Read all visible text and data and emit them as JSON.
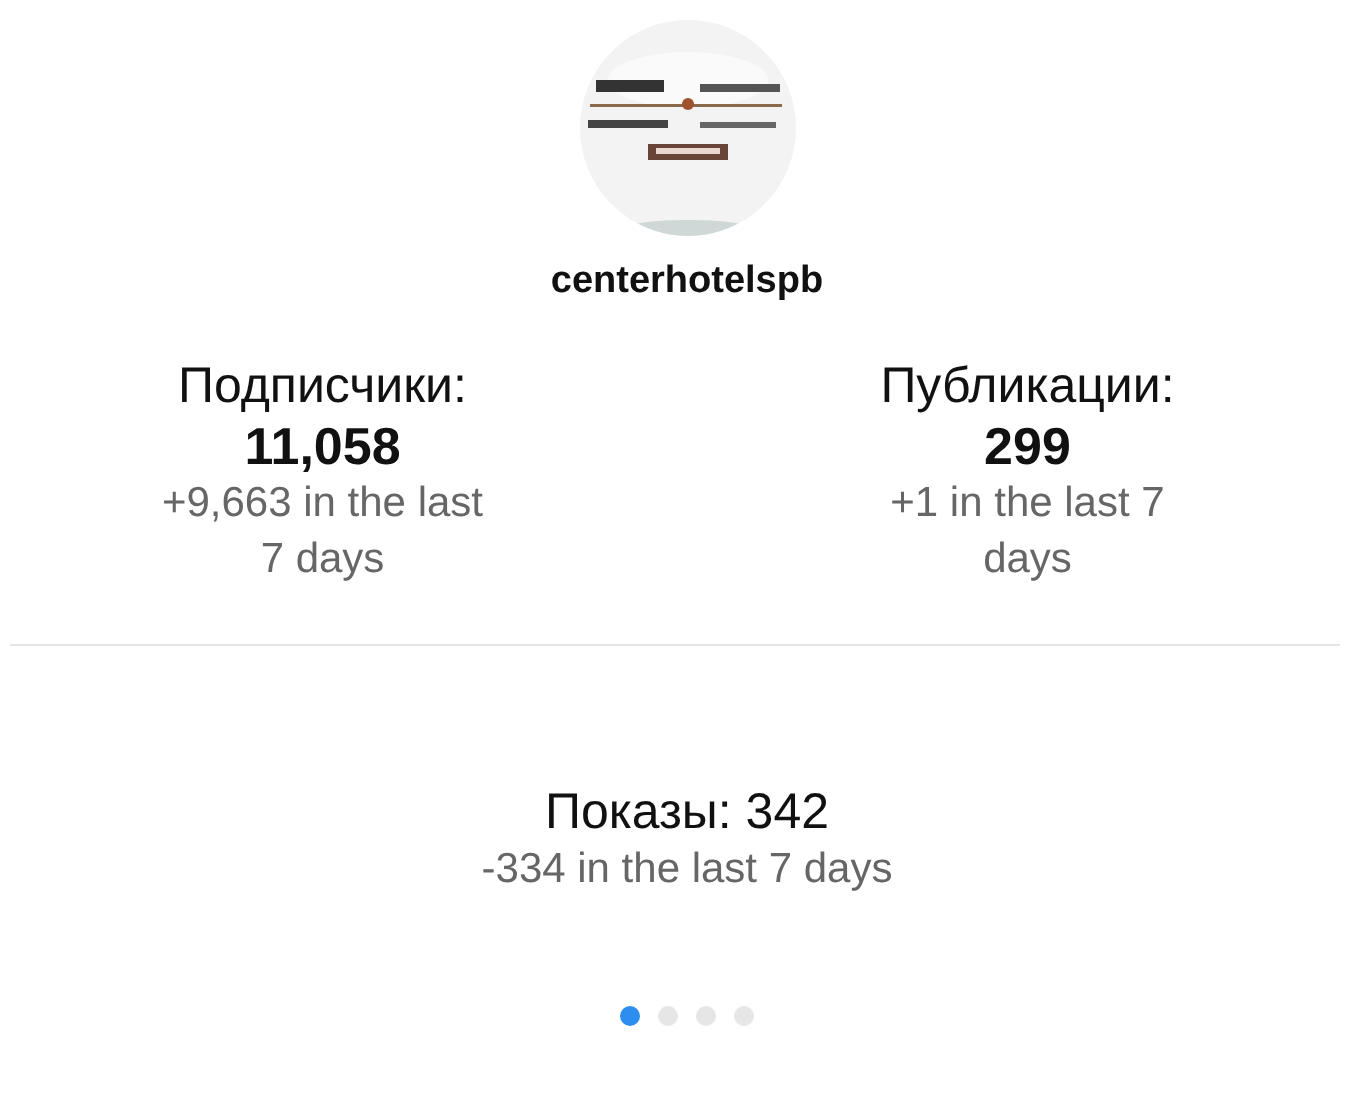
{
  "profile": {
    "username": "centerhotelspb"
  },
  "stats": [
    {
      "label": "Подписчики:",
      "value": "11,058",
      "change": "+9,663 in the last 7 days"
    },
    {
      "label": "Публикации:",
      "value": "299",
      "change": "+1 in the last 7 days"
    }
  ],
  "impressions": {
    "label": "Показы: 342",
    "change": "-334 in the last 7 days"
  },
  "pager": [
    {
      "selected": true
    },
    {
      "selected": false
    },
    {
      "selected": false
    },
    {
      "selected": false
    }
  ]
}
